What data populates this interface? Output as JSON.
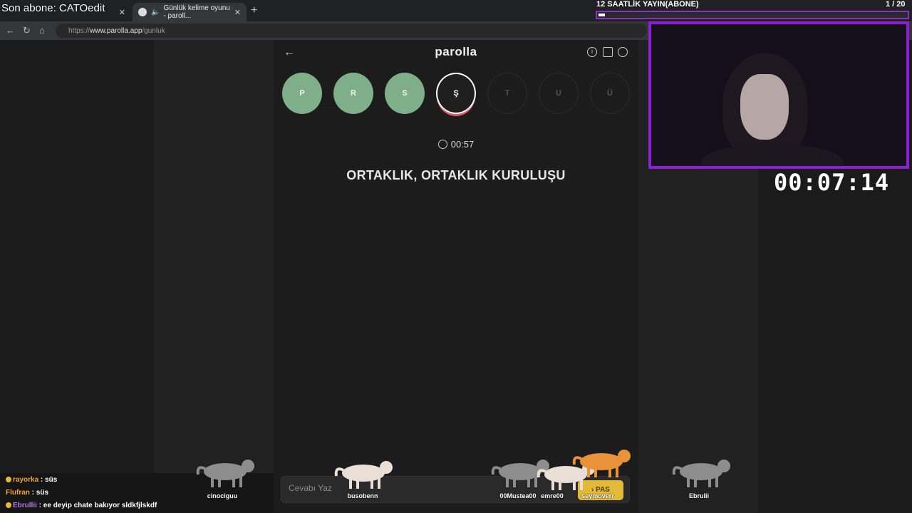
{
  "browser": {
    "tabs": [
      {
        "label": "Son abone: CATOedit",
        "active": false
      },
      {
        "label": "Günlük kelime oyunu - paroll...",
        "active": true
      }
    ],
    "url_prefix": "https://",
    "url_host": "www.parolla.app",
    "url_path": "/gunluk"
  },
  "overlay": {
    "last_sub": "Son abone: CATOedit",
    "goal_title": "12 SAATLİK YAYIN(ABONE)",
    "goal_count": "1 / 20",
    "goal_progress": 0.05,
    "stopwatch": "00:07:14"
  },
  "game": {
    "logo": "parolla",
    "letters": [
      {
        "char": "P",
        "state": "done"
      },
      {
        "char": "R",
        "state": "done"
      },
      {
        "char": "S",
        "state": "done"
      },
      {
        "char": "Ş",
        "state": "current"
      },
      {
        "char": "T",
        "state": "todo"
      },
      {
        "char": "U",
        "state": "todo"
      },
      {
        "char": "Ü",
        "state": "todo"
      }
    ],
    "timer": "00:57",
    "clue": "ORTAKLIK, ORTAKLIK KURULUŞU",
    "answer_placeholder": "Cevabı Yaz",
    "pass_label": "PAS"
  },
  "chat": [
    {
      "user": "rayorka",
      "text": ": süs",
      "color": "#f2a33a"
    },
    {
      "user": "Flufran",
      "text": ": süs",
      "color": "#f2a33a"
    },
    {
      "user": "Ebrullii",
      "text": ": ee deyip chate bakıyor sldkfjlskdf",
      "color": "#b07ce0"
    }
  ],
  "cats": [
    {
      "name": "cinociguu",
      "color": "#8d8d8d"
    },
    {
      "name": "busobenn",
      "color": "#e9dfd7"
    },
    {
      "name": "00Mustea00",
      "color": "#8d8d8d"
    },
    {
      "name": "emre00",
      "color": "#e9dfd7"
    },
    {
      "name": "seymoverr",
      "color": "#e8923a"
    },
    {
      "name": "Ebrulii",
      "color": "#8d8d8d"
    }
  ]
}
